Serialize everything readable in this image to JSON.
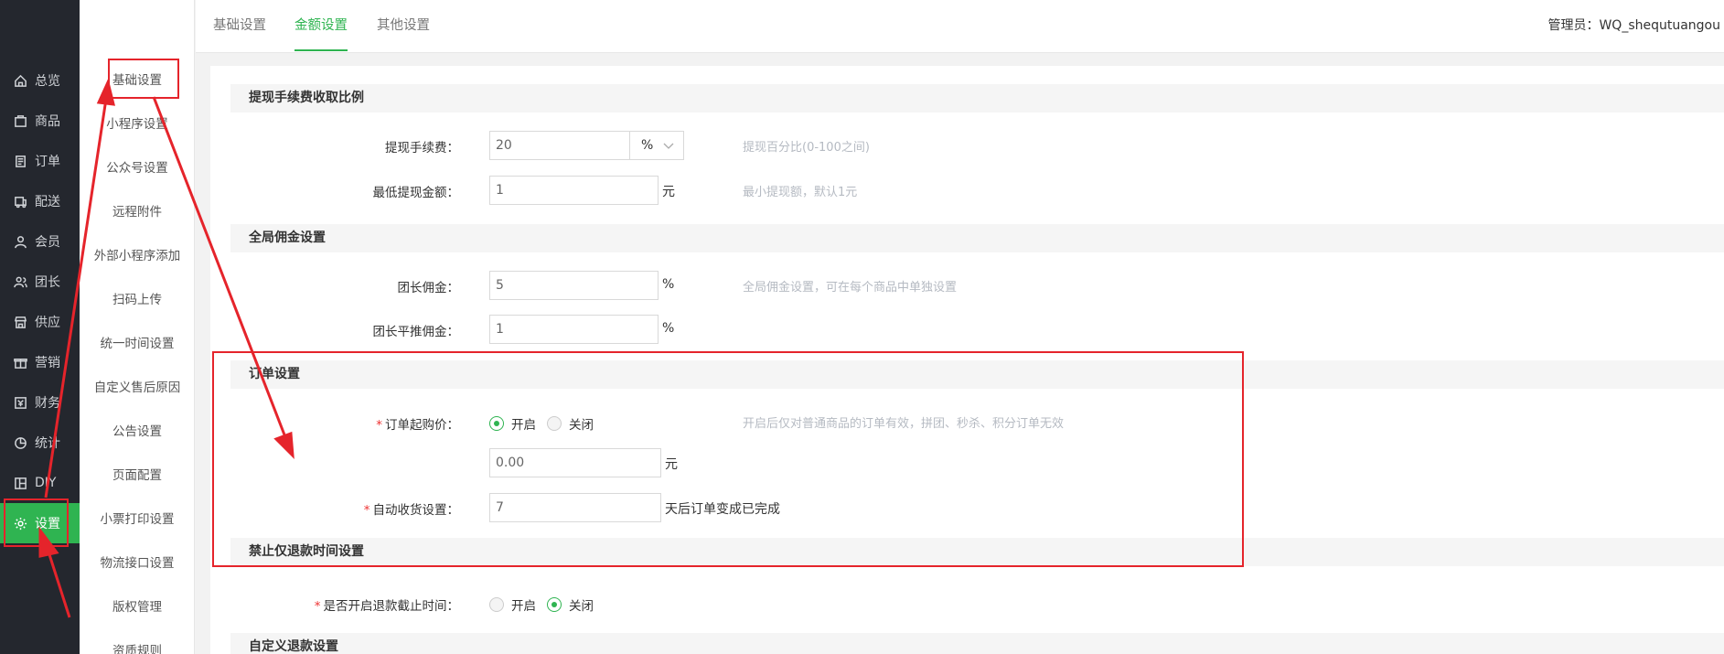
{
  "sidebar": {
    "items": [
      {
        "label": "总览",
        "icon": "home-icon"
      },
      {
        "label": "商品",
        "icon": "product-icon"
      },
      {
        "label": "订单",
        "icon": "order-icon"
      },
      {
        "label": "配送",
        "icon": "delivery-icon"
      },
      {
        "label": "会员",
        "icon": "member-icon"
      },
      {
        "label": "团长",
        "icon": "leader-icon"
      },
      {
        "label": "供应",
        "icon": "supply-icon"
      },
      {
        "label": "营销",
        "icon": "gift-icon"
      },
      {
        "label": "财务",
        "icon": "finance-icon"
      },
      {
        "label": "统计",
        "icon": "pie-chart-icon"
      },
      {
        "label": "DIY",
        "icon": "layout-icon"
      },
      {
        "label": "设置",
        "icon": "gear-icon"
      }
    ],
    "active_index": 11,
    "active_color": "#2fb451"
  },
  "subnav": {
    "items": [
      "基础设置",
      "小程序设置",
      "公众号设置",
      "远程附件",
      "外部小程序添加",
      "扫码上传",
      "统一时间设置",
      "自定义售后原因",
      "公告设置",
      "页面配置",
      "小票打印设置",
      "物流接口设置",
      "版权管理",
      "资质规则"
    ]
  },
  "topbar": {
    "tabs": [
      "基础设置",
      "金额设置",
      "其他设置"
    ],
    "active_tab": 1,
    "admin_label": "管理员：",
    "admin_name": "WQ_shequtuangou"
  },
  "withdraw": {
    "title": "提现手续费收取比例",
    "fee_label": "提现手续费：",
    "fee_value": "20",
    "fee_unit": "%",
    "fee_hint": "提现百分比(0-100之间)",
    "min_label": "最低提现金额：",
    "min_value": "1",
    "min_unit": "元",
    "min_hint": "最小提现额，默认1元"
  },
  "commission": {
    "title": "全局佣金设置",
    "leader_label": "团长佣金：",
    "leader_value": "5",
    "leader_unit": "%",
    "leader_hint": "全局佣金设置，可在每个商品中单独设置",
    "referral_label": "团长平推佣金：",
    "referral_value": "1",
    "referral_unit": "%"
  },
  "order": {
    "title": "订单设置",
    "min_price_label": "订单起购价：",
    "option_on": "开启",
    "option_off": "关闭",
    "min_price_enabled": true,
    "min_price_hint": "开启后仅对普通商品的订单有效，拼团、秒杀、积分订单无效",
    "min_price_value": "0.00",
    "min_price_unit": "元",
    "auto_receive_label": "自动收货设置：",
    "auto_receive_value": "7",
    "auto_receive_suffix": "天后订单变成已完成"
  },
  "refund_time": {
    "title": "禁止仅退款时间设置",
    "label": "是否开启退款截止时间：",
    "option_on": "开启",
    "option_off": "关闭",
    "enabled": false
  },
  "custom_refund": {
    "title": "自定义退款设置"
  },
  "annotation_color": "#e5242b"
}
